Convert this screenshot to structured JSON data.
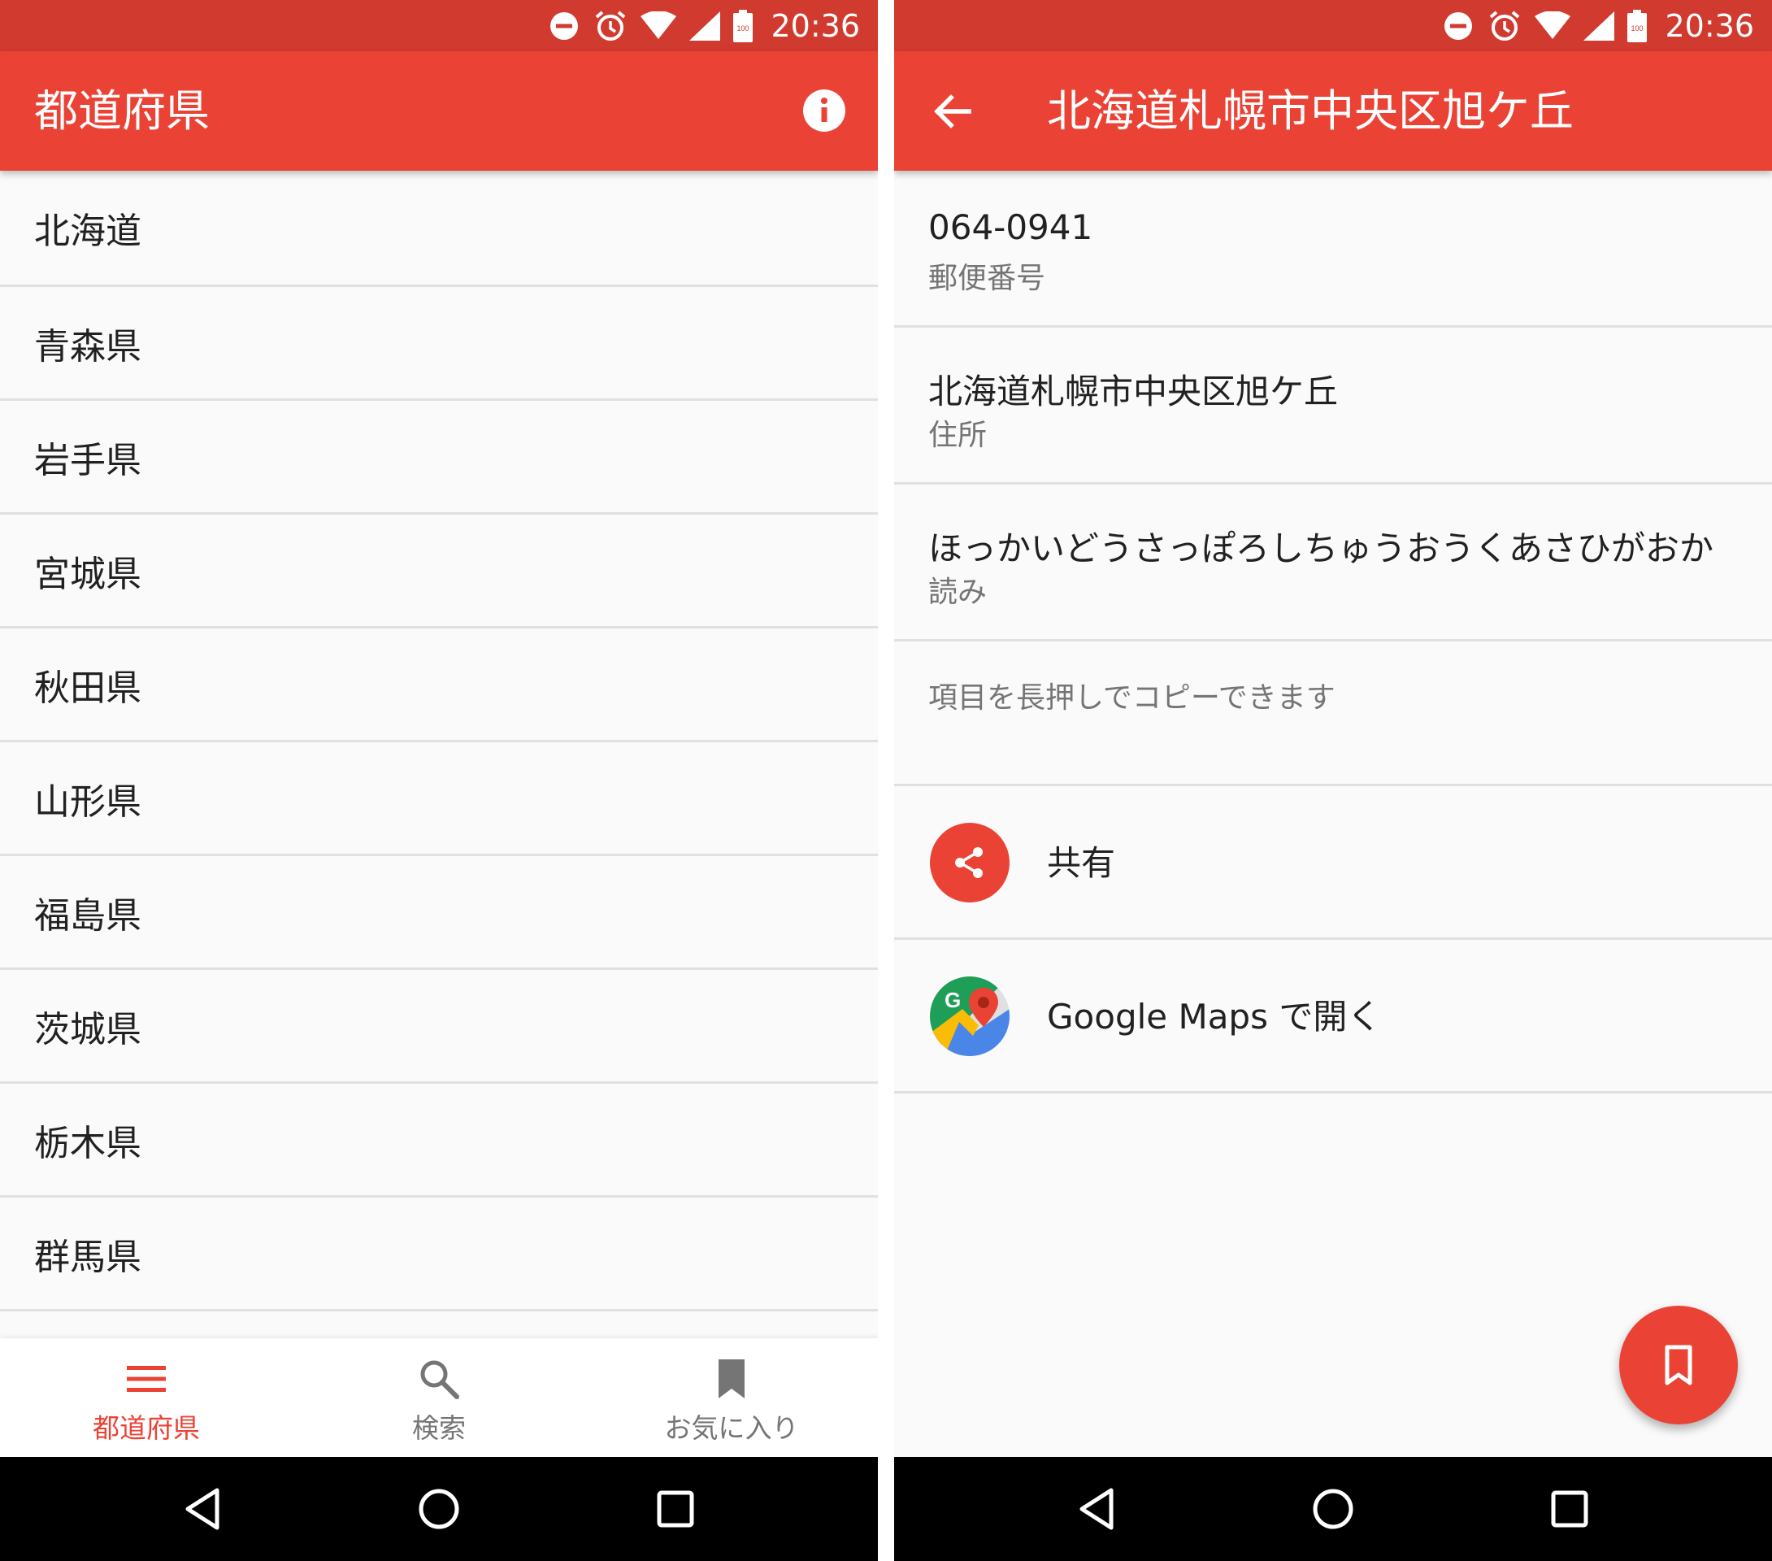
{
  "status": {
    "time": "20:36",
    "battery": "100"
  },
  "left": {
    "title": "都道府県",
    "prefectures": [
      "北海道",
      "青森県",
      "岩手県",
      "宮城県",
      "秋田県",
      "山形県",
      "福島県",
      "茨城県",
      "栃木県",
      "群馬県"
    ],
    "bottom_nav": {
      "prefectures": "都道府県",
      "search": "検索",
      "favorites": "お気に入り"
    }
  },
  "right": {
    "title": "北海道札幌市中央区旭ケ丘",
    "postal_code": {
      "value": "064-0941",
      "label": "郵便番号"
    },
    "address": {
      "value": "北海道札幌市中央区旭ケ丘",
      "label": "住所"
    },
    "reading": {
      "value": "ほっかいどうさっぽろしちゅうおうくあさひがおか",
      "label": "読み"
    },
    "hint": "項目を長押しでコピーできます",
    "share_label": "共有",
    "maps_label": "Google Maps で開く",
    "maps_badge": "G"
  },
  "colors": {
    "primary": "#ea4336",
    "status": "#d13a2f",
    "accent_text": "#ea4336"
  },
  "icons": [
    "dnd-icon",
    "alarm-icon",
    "wifi-icon",
    "signal-icon",
    "battery-icon",
    "info-icon",
    "back-arrow-icon",
    "menu-icon",
    "search-icon",
    "bookmark-icon",
    "share-icon",
    "google-maps-icon",
    "nav-back-icon",
    "nav-home-icon",
    "nav-recents-icon"
  ]
}
